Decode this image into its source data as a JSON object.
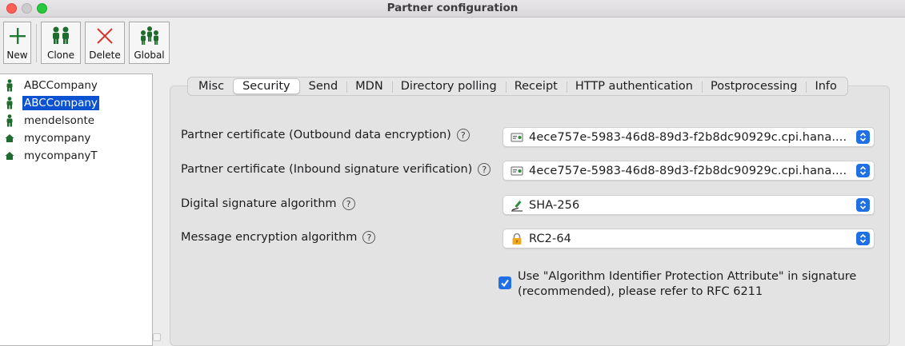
{
  "window": {
    "title": "Partner configuration"
  },
  "toolbar": {
    "new_label": "New",
    "clone_label": "Clone",
    "delete_label": "Delete",
    "global_label": "Global"
  },
  "partners": [
    {
      "label": "ABCCompany",
      "icon": "remote-partner-icon",
      "selected": false
    },
    {
      "label": "ABCCompany",
      "icon": "remote-partner-icon",
      "selected": true
    },
    {
      "label": "mendelsonte",
      "icon": "remote-partner-icon",
      "selected": false
    },
    {
      "label": "mycompany",
      "icon": "local-station-icon",
      "selected": false
    },
    {
      "label": "mycompanyT",
      "icon": "local-station-icon",
      "selected": false
    }
  ],
  "tabs": [
    {
      "label": "Misc",
      "active": false
    },
    {
      "label": "Security",
      "active": true
    },
    {
      "label": "Send",
      "active": false
    },
    {
      "label": "MDN",
      "active": false
    },
    {
      "label": "Directory polling",
      "active": false
    },
    {
      "label": "Receipt",
      "active": false
    },
    {
      "label": "HTTP authentication",
      "active": false
    },
    {
      "label": "Postprocessing",
      "active": false
    },
    {
      "label": "Info",
      "active": false
    }
  ],
  "security": {
    "encryption_cert": {
      "label": "Partner certificate (Outbound data encryption)",
      "value": "4ece757e-5983-46d8-89d3-f2b8dc90929c.cpi.hana....",
      "icon": "certificate-icon"
    },
    "signature_cert": {
      "label": "Partner certificate (Inbound signature verification)",
      "value": "4ece757e-5983-46d8-89d3-f2b8dc90929c.cpi.hana....",
      "icon": "certificate-icon"
    },
    "signature_algorithm": {
      "label": "Digital signature algorithm",
      "value": "SHA-256",
      "icon": "signature-pen-icon"
    },
    "encryption_algorithm": {
      "label": "Message encryption algorithm",
      "value": "RC2-64",
      "icon": "lock-icon"
    },
    "algorithm_protection": {
      "checked": true,
      "label": "Use \"Algorithm Identifier Protection Attribute\" in signature (recommended), please refer to RFC 6211"
    },
    "help_glyph": "?"
  },
  "colors": {
    "accent": "#1f6fe5",
    "selection": "#0b52d1",
    "partner_green": "#1e6b2e"
  }
}
